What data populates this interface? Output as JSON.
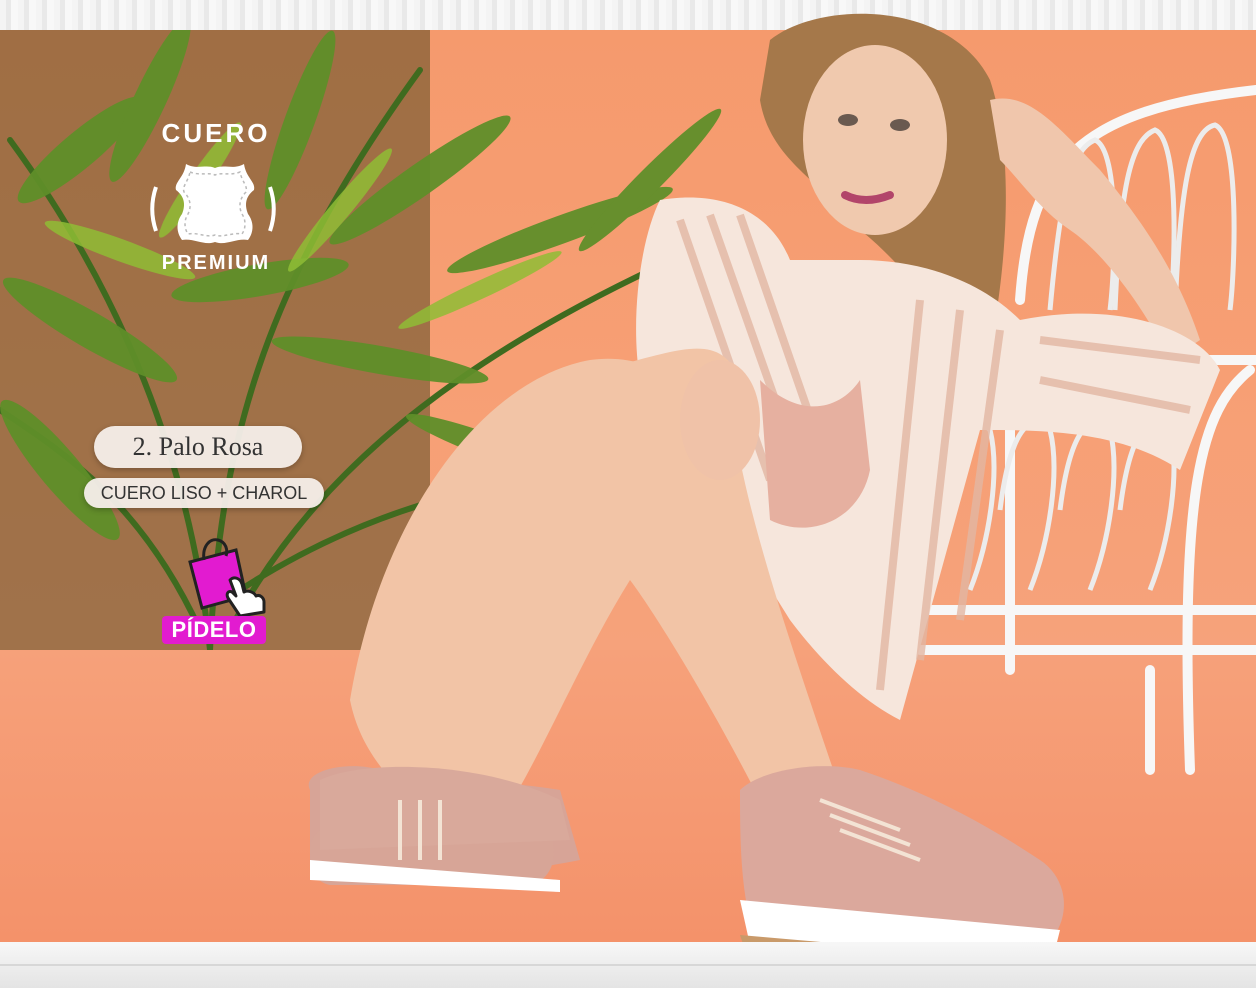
{
  "badge": {
    "top_text": "CUERO",
    "bottom_text": "PREMIUM",
    "icon": "leather-hide-icon"
  },
  "product": {
    "name": "2. Palo Rosa",
    "material": "CUERO LISO + CHAROL"
  },
  "cta": {
    "label": "PÍDELO",
    "icon": "shopping-bag-icon",
    "accent": "#e21bd0"
  },
  "colors": {
    "backdrop": "#f59a6d",
    "shoe": "#d9a69c"
  }
}
